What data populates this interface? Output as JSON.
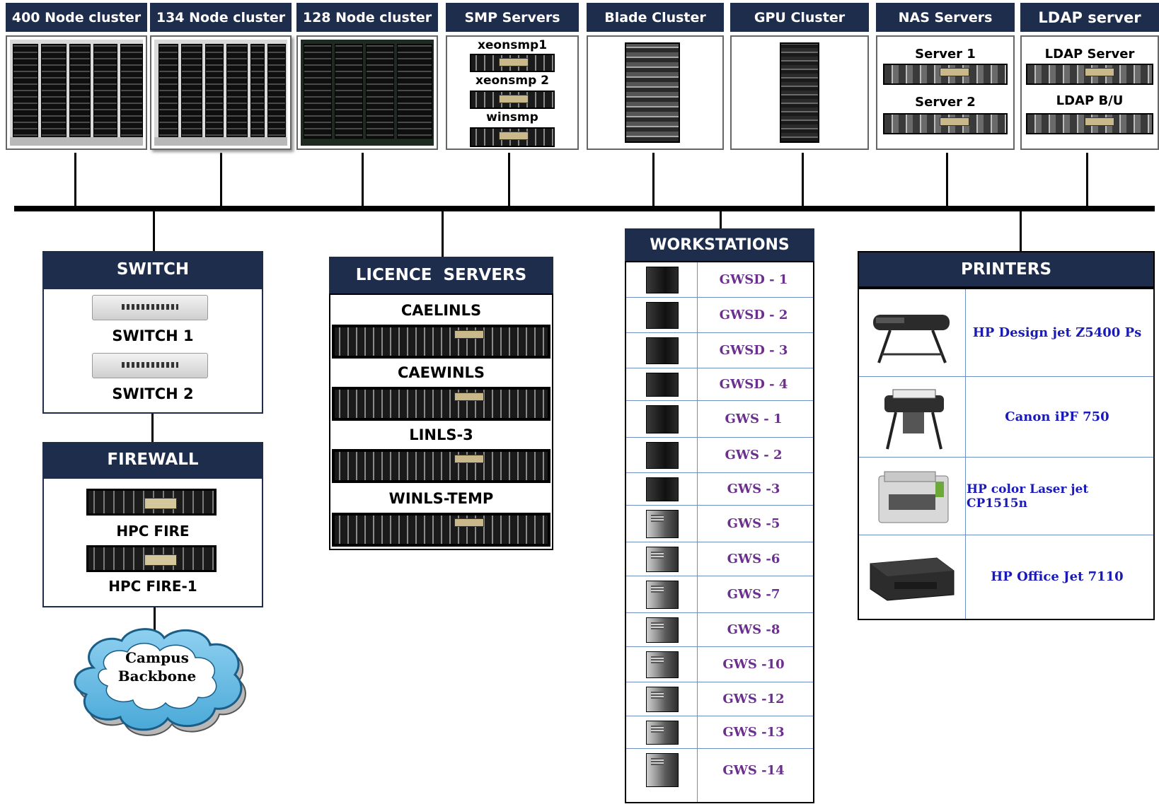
{
  "top_nodes": [
    {
      "title": "400 Node cluster"
    },
    {
      "title": "134 Node cluster"
    },
    {
      "title": "128 Node cluster"
    },
    {
      "title": "SMP Servers",
      "items": [
        "xeonsmp1",
        "xeonsmp 2",
        "winsmp"
      ]
    },
    {
      "title": "Blade Cluster"
    },
    {
      "title": "GPU Cluster"
    },
    {
      "title": "NAS Servers",
      "items": [
        "Server 1",
        "Server 2"
      ]
    },
    {
      "title": "LDAP server",
      "items": [
        "LDAP Server",
        "LDAP B/U"
      ]
    }
  ],
  "switch": {
    "title": "SWITCH",
    "items": [
      "SWITCH 1",
      "SWITCH 2"
    ]
  },
  "firewall": {
    "title": "FIREWALL",
    "items": [
      "HPC FIRE",
      "HPC FIRE-1"
    ]
  },
  "backbone": {
    "line1": "Campus",
    "line2": "Backbone"
  },
  "licence": {
    "title": "LICENCE  SERVERS",
    "items": [
      "CAELINLS",
      "CAEWINLS",
      "LINLS-3",
      "WINLS-TEMP"
    ]
  },
  "workstations": {
    "title": "WORKSTATIONS",
    "items": [
      {
        "name": "GWSD - 1",
        "icon": "black-tower-icon"
      },
      {
        "name": "GWSD - 2",
        "icon": "black-tower-icon"
      },
      {
        "name": "GWSD - 3",
        "icon": "black-tower-icon"
      },
      {
        "name": "GWSD - 4",
        "icon": "black-tower-icon"
      },
      {
        "name": "GWS - 1",
        "icon": "black-tower-icon"
      },
      {
        "name": "GWS - 2",
        "icon": "black-tower-icon"
      },
      {
        "name": "GWS -3",
        "icon": "black-tower-icon"
      },
      {
        "name": "GWS -5",
        "icon": "silver-tower-icon"
      },
      {
        "name": "GWS -6",
        "icon": "silver-tower-icon"
      },
      {
        "name": "GWS -7",
        "icon": "silver-tower-icon"
      },
      {
        "name": "GWS -8",
        "icon": "silver-tower-icon"
      },
      {
        "name": "GWS -10",
        "icon": "silver-tower-icon"
      },
      {
        "name": "GWS -12",
        "icon": "silver-tower-icon"
      },
      {
        "name": "GWS -13",
        "icon": "silver-tower-icon"
      },
      {
        "name": "GWS -14",
        "icon": "silver-tower-icon"
      }
    ]
  },
  "printers": {
    "title": "PRINTERS",
    "items": [
      {
        "name": "HP Design jet Z5400 Ps",
        "icon": "wide-format-printer-icon"
      },
      {
        "name": "Canon iPF 750",
        "icon": "wide-format-printer-icon"
      },
      {
        "name": "HP color Laser jet  CP1515n",
        "icon": "laser-printer-icon"
      },
      {
        "name": "HP  Office Jet 7110",
        "icon": "inkjet-printer-icon"
      }
    ]
  },
  "colors": {
    "header_bg": "#1f2d4d",
    "workstation_text": "#6b2f8e",
    "printer_text": "#1a1ab8",
    "row_divider": "#6d8fc4"
  }
}
